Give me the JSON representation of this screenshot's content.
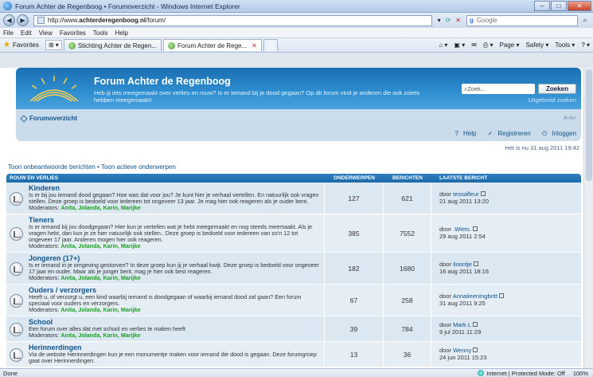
{
  "window": {
    "title": "Forum Achter de Regenboog • Forumoverzicht - Windows Internet Explorer"
  },
  "addressbar": {
    "url_prefix": "http://www.",
    "url_domain": "achterderegenboog.nl",
    "url_suffix": "/forum/",
    "search_placeholder": "Google"
  },
  "menubar": {
    "items": [
      "File",
      "Edit",
      "View",
      "Favorites",
      "Tools",
      "Help"
    ]
  },
  "favbar": {
    "favorites_label": "Favorites",
    "tabs": [
      {
        "label": "Stichting Achter de Regen..."
      },
      {
        "label": "Forum Achter de Rege..."
      }
    ],
    "commands": [
      "Page ▾",
      "Safety ▾",
      "Tools ▾"
    ]
  },
  "forum": {
    "title": "Forum Achter de Regenboog",
    "description": "Heb jij iets meegemaakt over verlies en rouw? Is er iemand bij je dood gegaan? Op dit forum vind je anderen die ook zoiets hebben meegemaakt!",
    "search_placeholder": "Zoek...",
    "search_button": "Zoeken",
    "advanced_search": "Uitgebreid zoeken",
    "breadcrumb": "Forumoverzicht",
    "font_size_control": "A-A+",
    "user_links": {
      "help": "Help",
      "register": "Registreren",
      "login": "Inloggen"
    },
    "current_time": "Het is nu 31 aug 2011 19:42",
    "topic_links": "Toon onbeantwoorde berichten • Toon actieve onderwerpen",
    "table_header": {
      "forum": "ROUW EN VERLIES",
      "topics": "ONDERWERPEN",
      "posts": "BERICHTEN",
      "last": "LAATSTE BERICHT"
    },
    "rows": [
      {
        "name": "Kinderen",
        "text": "Is er bij jou iemand dood gegaan? Hoe was dat voor jou? Je kunt hier je verhaal vertellen. En natuurlijk ook vragen stellen. Deze groep is bedoeld voor iedereen tot ongeveer 13 jaar. Je mag hier ook reageren als je ouder bent.",
        "mods_label": "Moderators:",
        "mods": "Anita, Jolanda, Karin, Marijke",
        "topics": "127",
        "posts": "621",
        "last_by": "door",
        "last_author": "tessafleur",
        "last_date": "21 aug 2011 13:20"
      },
      {
        "name": "Tieners",
        "text": "Is er iemand bij jou doodgegaan? Hier kun je vertellen wat je hebt meegemaakt en nog steeds meemaakt. Als je vragen hebt, dan kun je ze hier natuurlijk ook stellen.. Deze groep is bedoeld voor iedereen van zo'n 12 tot ongeveer 17 jaar. Anderen mogen hier ook reageren.",
        "mods_label": "Moderators:",
        "mods": "Anita, Jolanda, Karin, Marijke",
        "topics": "385",
        "posts": "7552",
        "last_by": "door",
        "last_author": ".Wiets.",
        "last_date": "29 aug 2011 2:54"
      },
      {
        "name": "Jongeren (17+)",
        "text": "Is er iemand in je omgeving gestorven? In deze groep kun jij je verhaal kwijt. Deze groep is bedoeld voor ongeveer 17 jaar en ouder. Maar als je jonger bent, mag je hier ook best reageren.",
        "mods_label": "Moderators:",
        "mods": "Anita, Jolanda, Karin, Marijke",
        "topics": "182",
        "posts": "1680",
        "last_by": "door",
        "last_author": "iloontje",
        "last_date": "16 aug 2011 18:16"
      },
      {
        "name": "Ouders / verzorgers",
        "text": "Heeft u, of verzorgt u, een kind waarbij iemand is doodgegaan of waarbij iemand dood zal gaan? Een forum speciaal voor ouders en verzorgers.",
        "mods_label": "Moderators:",
        "mods": "Anita, Jolanda, Karin, Marijke",
        "topics": "67",
        "posts": "258",
        "last_by": "door",
        "last_author": "AnnalieenIngbritt",
        "last_date": "31 aug 2011 9:25"
      },
      {
        "name": "School",
        "text": "Een forum over alles dat met school en verlies te maken heeft",
        "mods_label": "Moderators:",
        "mods": "Anita, Jolanda, Karin, Marijke",
        "topics": "39",
        "posts": "784",
        "last_by": "door",
        "last_author": "Mark L",
        "last_date": "9 jul 2011 11:29"
      },
      {
        "name": "Herinnerdingen",
        "text": "Via de website Herinnerdingen kun je een monumentje maken voor iemand die dood is gegaan. Deze forumgroep gaat over Herinnerdingen.",
        "mods_label": "",
        "mods": "",
        "topics": "13",
        "posts": "36",
        "last_by": "door",
        "last_author": "Wenny",
        "last_date": "24 jun 2011 15:23"
      }
    ]
  },
  "statusbar": {
    "left": "Done",
    "zone": "Internet | Protected Mode: Off",
    "zoom": "100%"
  },
  "colors": {
    "header_blue": "#1a6fb2",
    "link_blue": "#105289",
    "moderator_green": "#17a31e",
    "row_bg": "#dbe7f1"
  }
}
